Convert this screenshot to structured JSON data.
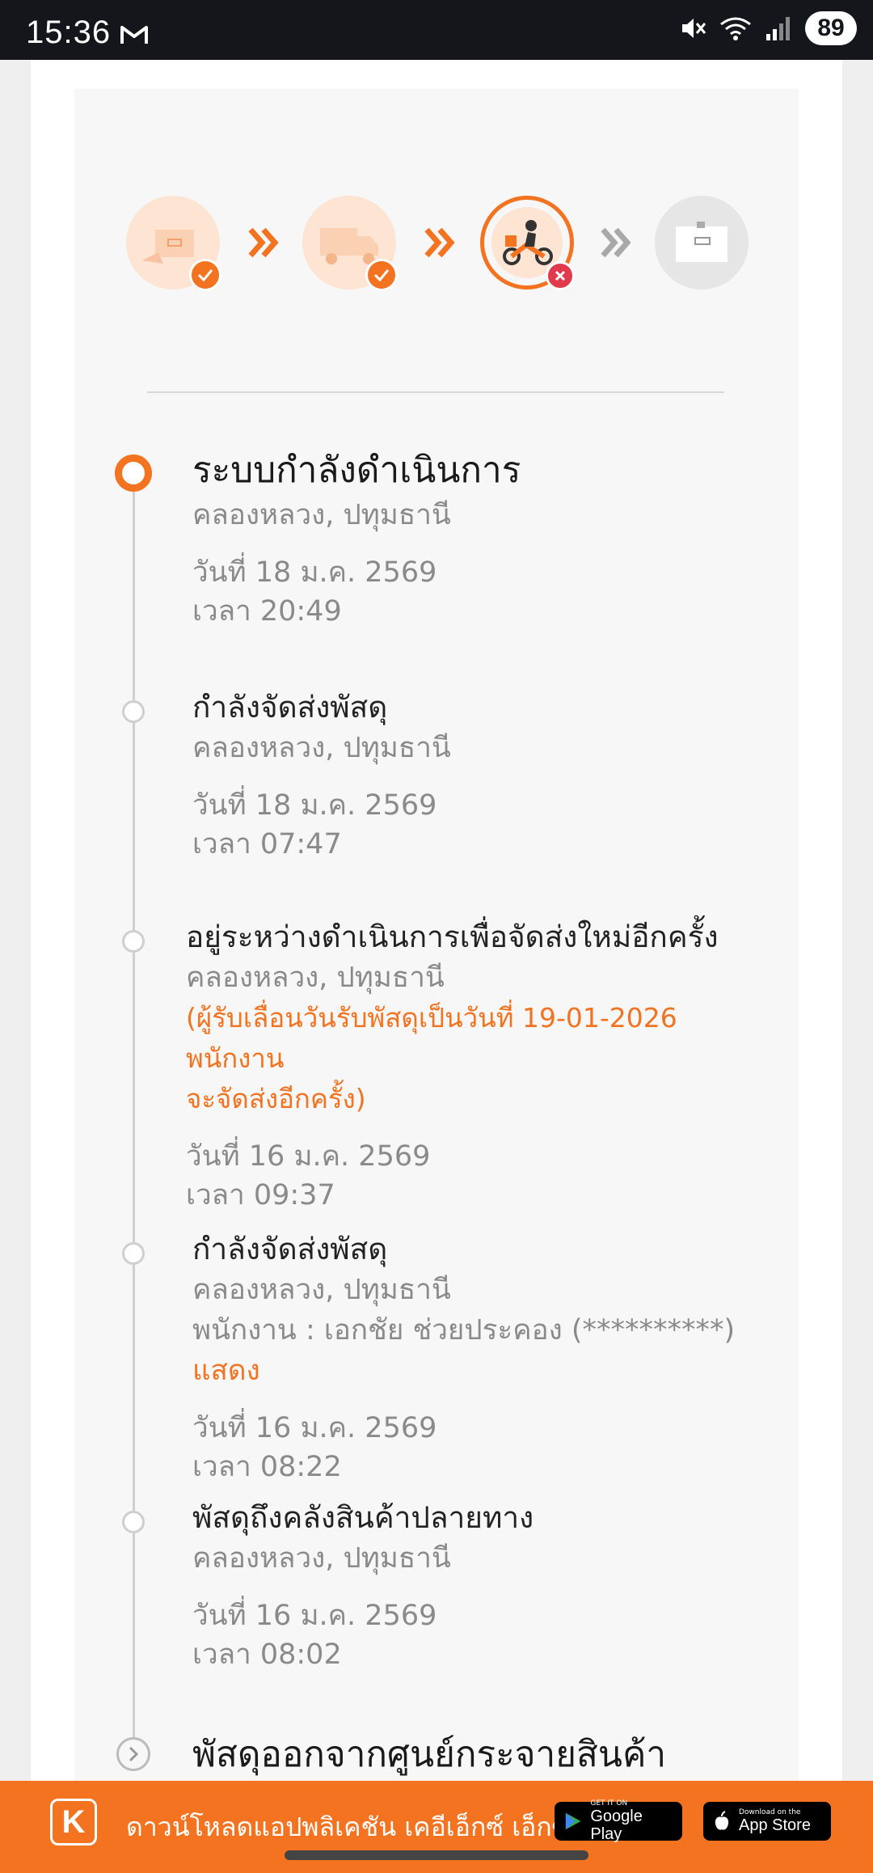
{
  "status_bar": {
    "time": "15:36",
    "battery": "89"
  },
  "progress_steps": [
    {
      "name": "parcel-received",
      "state": "done"
    },
    {
      "name": "in-transit-truck",
      "state": "done"
    },
    {
      "name": "delivering-motorbike",
      "state": "failed"
    },
    {
      "name": "delivered-box",
      "state": "pending"
    }
  ],
  "timeline": [
    {
      "title": "ระบบกำลังดำเนินการ",
      "location": "คลองหลวง, ปทุมธานี",
      "date": "วันที่ 18 ม.ค. 2569",
      "time": "เวลา 20:49"
    },
    {
      "title": "กำลังจัดส่งพัสดุ",
      "location": "คลองหลวง, ปทุมธานี",
      "date": "วันที่ 18 ม.ค. 2569",
      "time": "เวลา 07:47"
    },
    {
      "title": "อยู่ระหว่างดำเนินการเพื่อจัดส่งใหม่อีกครั้ง",
      "location": "คลองหลวง, ปทุมธานี",
      "note_line1": "(ผู้รับเลื่อนวันรับพัสดุเป็นวันที่ 19-01-2026 พนักงาน",
      "note_line2": "จะจัดส่งอีกครั้ง)",
      "date": "วันที่ 16 ม.ค. 2569",
      "time": "เวลา 09:37"
    },
    {
      "title": "กำลังจัดส่งพัสดุ",
      "location": "คลองหลวง, ปทุมธานี",
      "courier": "พนักงาน : เอกชัย ช่วยประคอง (**********)",
      "show_label": "แสดง",
      "date": "วันที่ 16 ม.ค. 2569",
      "time": "เวลา 08:22"
    },
    {
      "title": "พัสดุถึงคลังสินค้าปลายทาง",
      "location": "คลองหลวง, ปทุมธานี",
      "date": "วันที่ 16 ม.ค. 2569",
      "time": "เวลา 08:02"
    },
    {
      "title": "พัสดุออกจากศูนย์กระจายสินค้า"
    }
  ],
  "banner": {
    "text": "ดาวน์โหลดแอปพลิเคชัน เคอีเอ็กซ์ เอ็กซ์เพรส",
    "google_small": "GET IT ON",
    "google_big": "Google Play",
    "apple_small": "Download on the",
    "apple_big": "App Store"
  },
  "colors": {
    "accent": "#f47321",
    "error": "#e23a4d"
  }
}
